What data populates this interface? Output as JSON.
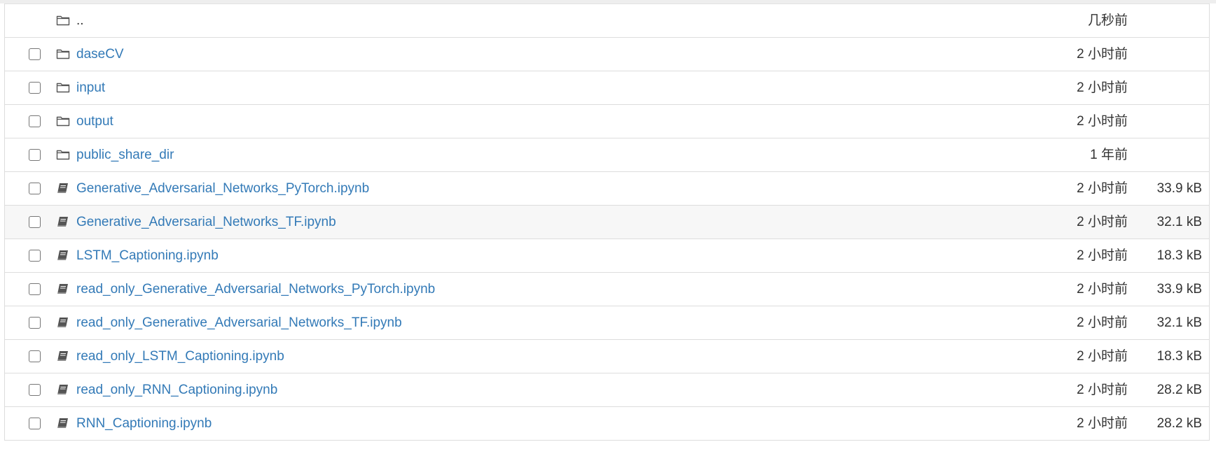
{
  "colors": {
    "link": "#337ab7",
    "text": "#333333",
    "border": "#dddddd",
    "row_hover": "#f7f7f7"
  },
  "file_list": {
    "rows": [
      {
        "type": "folder",
        "name": "..",
        "modified": "几秒前",
        "size": "",
        "has_checkbox": false,
        "icon": "folder-icon"
      },
      {
        "type": "folder",
        "name": "daseCV",
        "modified": "2 小时前",
        "size": "",
        "has_checkbox": true,
        "icon": "folder-icon"
      },
      {
        "type": "folder",
        "name": "input",
        "modified": "2 小时前",
        "size": "",
        "has_checkbox": true,
        "icon": "folder-icon"
      },
      {
        "type": "folder",
        "name": "output",
        "modified": "2 小时前",
        "size": "",
        "has_checkbox": true,
        "icon": "folder-icon"
      },
      {
        "type": "folder",
        "name": "public_share_dir",
        "modified": "1 年前",
        "size": "",
        "has_checkbox": true,
        "icon": "folder-icon"
      },
      {
        "type": "notebook",
        "name": "Generative_Adversarial_Networks_PyTorch.ipynb",
        "modified": "2 小时前",
        "size": "33.9 kB",
        "has_checkbox": true,
        "icon": "notebook-icon"
      },
      {
        "type": "notebook",
        "name": "Generative_Adversarial_Networks_TF.ipynb",
        "modified": "2 小时前",
        "size": "32.1 kB",
        "has_checkbox": true,
        "icon": "notebook-icon"
      },
      {
        "type": "notebook",
        "name": "LSTM_Captioning.ipynb",
        "modified": "2 小时前",
        "size": "18.3 kB",
        "has_checkbox": true,
        "icon": "notebook-icon"
      },
      {
        "type": "notebook",
        "name": "read_only_Generative_Adversarial_Networks_PyTorch.ipynb",
        "modified": "2 小时前",
        "size": "33.9 kB",
        "has_checkbox": true,
        "icon": "notebook-icon"
      },
      {
        "type": "notebook",
        "name": "read_only_Generative_Adversarial_Networks_TF.ipynb",
        "modified": "2 小时前",
        "size": "32.1 kB",
        "has_checkbox": true,
        "icon": "notebook-icon"
      },
      {
        "type": "notebook",
        "name": "read_only_LSTM_Captioning.ipynb",
        "modified": "2 小时前",
        "size": "18.3 kB",
        "has_checkbox": true,
        "icon": "notebook-icon"
      },
      {
        "type": "notebook",
        "name": "read_only_RNN_Captioning.ipynb",
        "modified": "2 小时前",
        "size": "28.2 kB",
        "has_checkbox": true,
        "icon": "notebook-icon"
      },
      {
        "type": "notebook",
        "name": "RNN_Captioning.ipynb",
        "modified": "2 小时前",
        "size": "28.2 kB",
        "has_checkbox": true,
        "icon": "notebook-icon"
      }
    ]
  }
}
